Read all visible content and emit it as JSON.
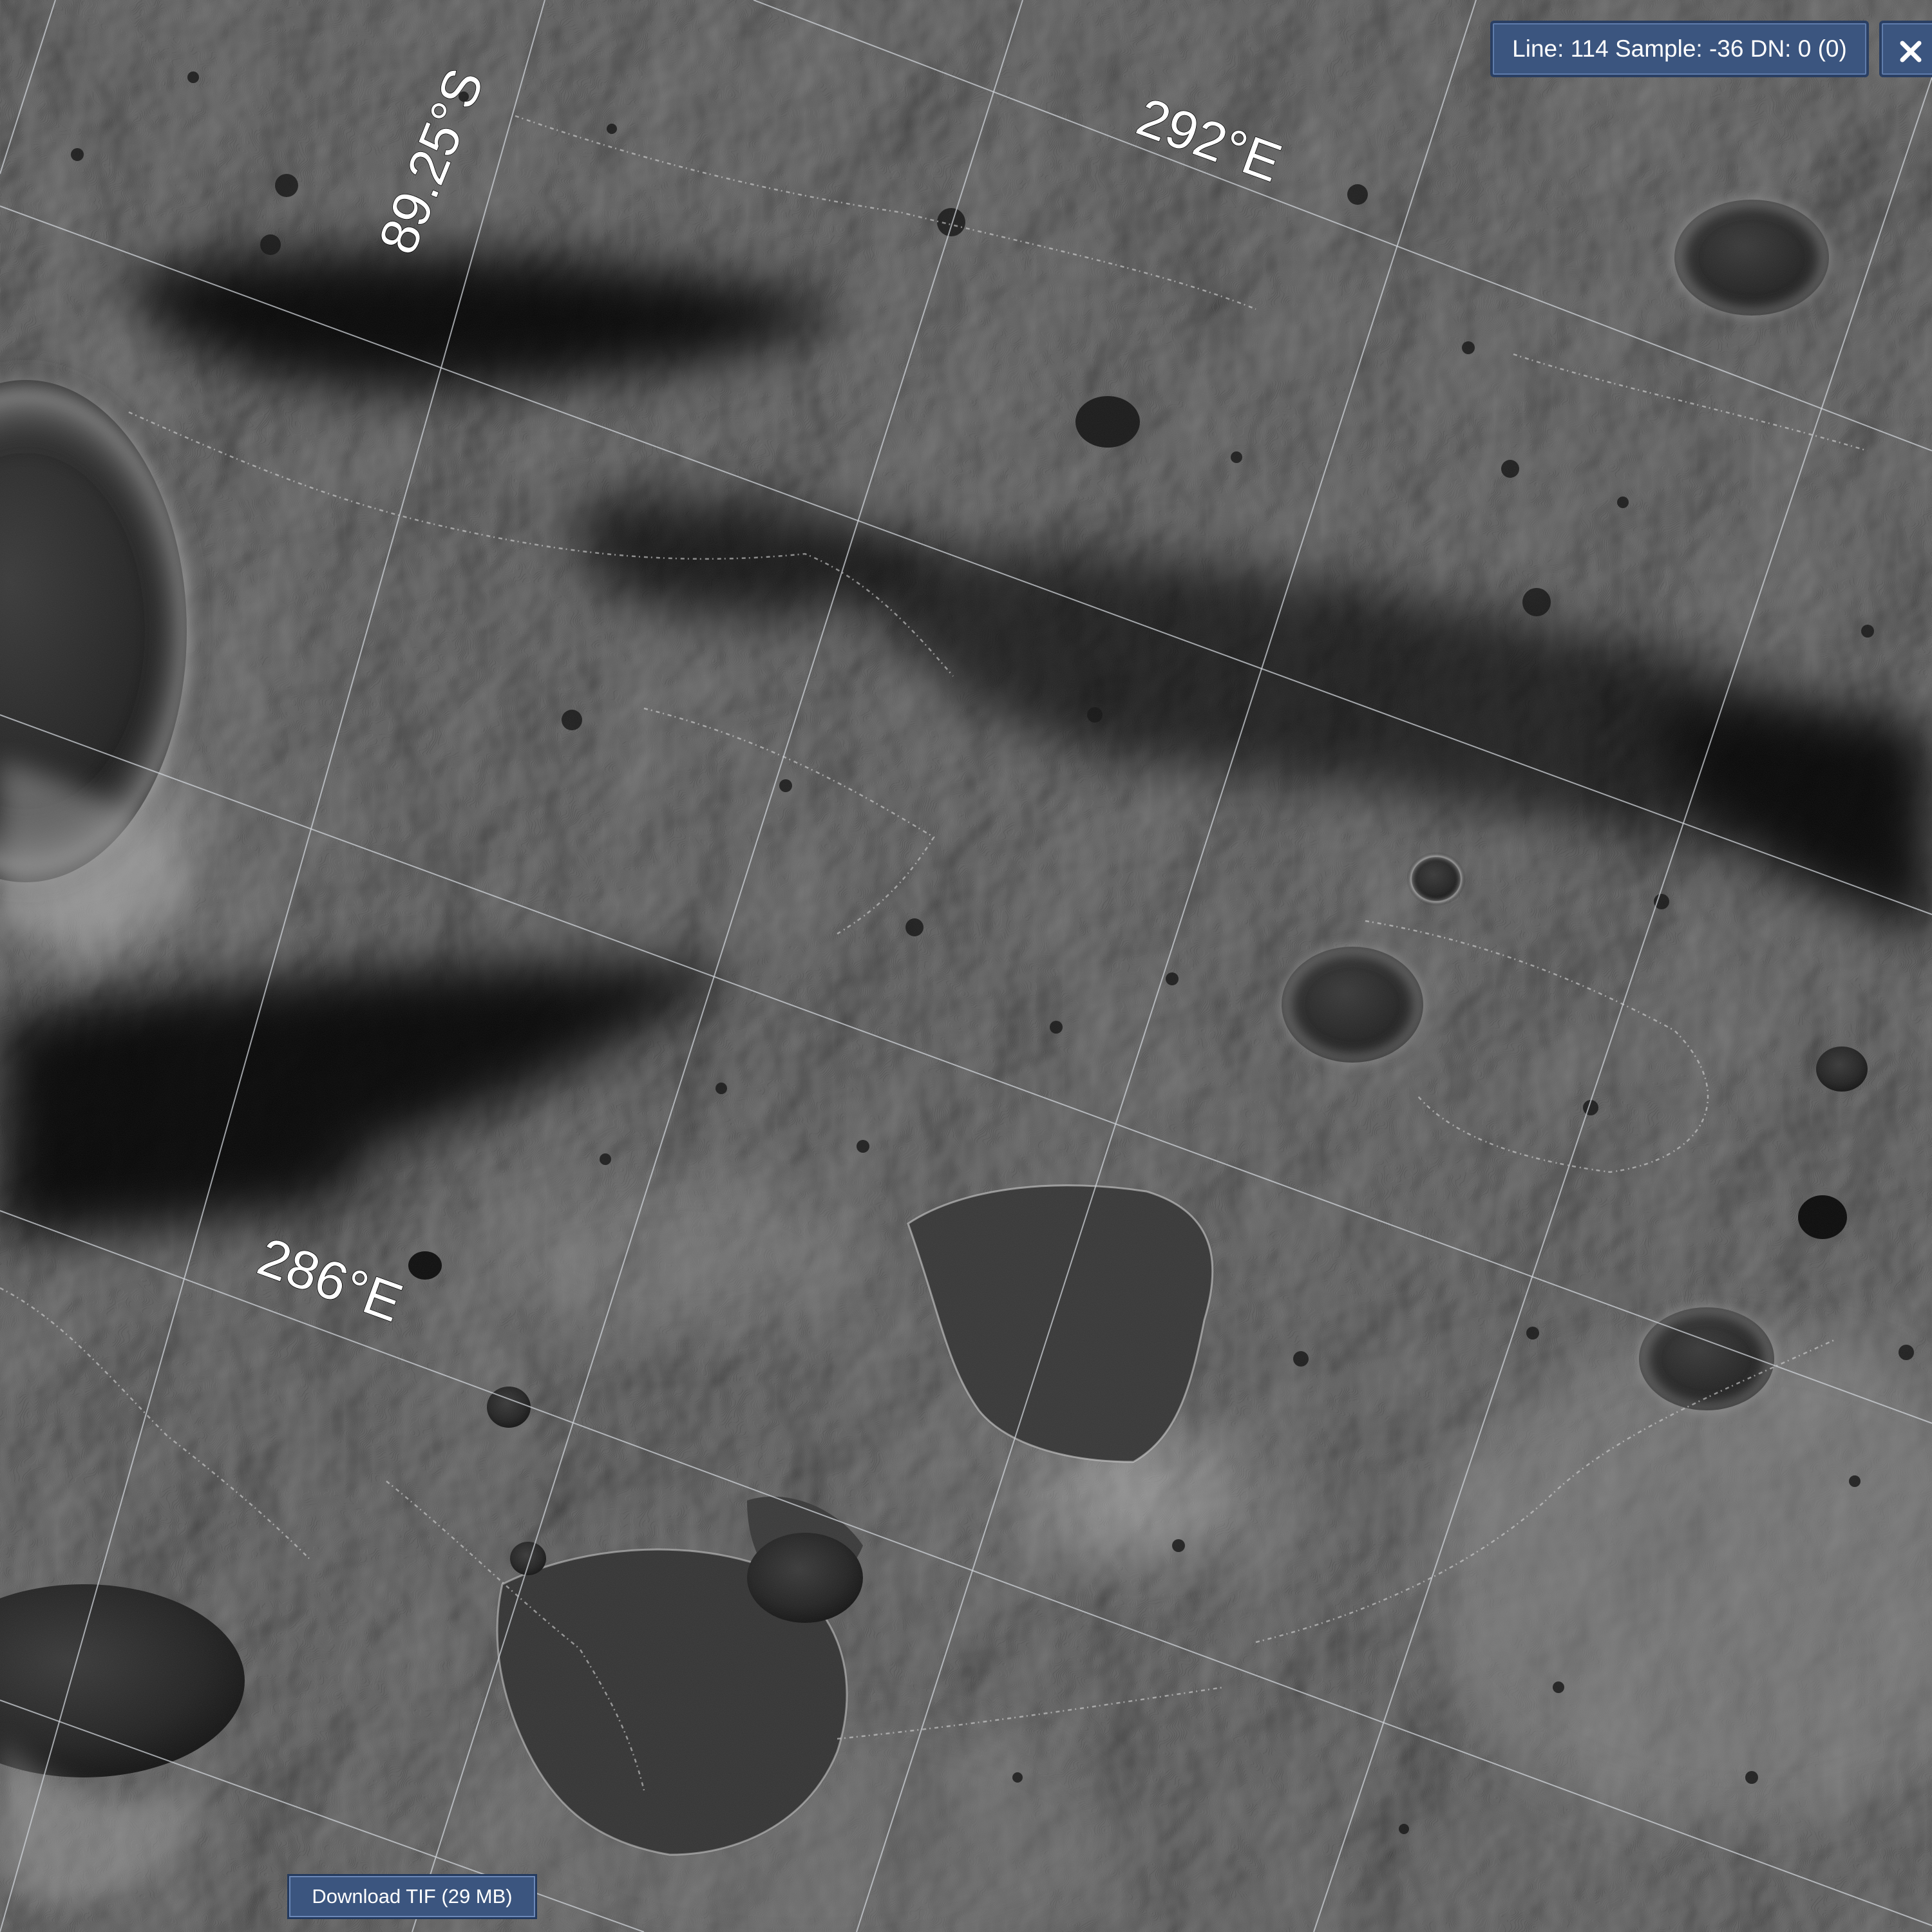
{
  "viewer": {
    "readout": "Line: 114 Sample: -36 DN: 0 (0)",
    "download_label": "Download TIF (29 MB)"
  },
  "map": {
    "grid_labels": {
      "latitude": "89.25°S",
      "longitude_top": "292°E",
      "longitude_bottom": "286°E"
    }
  },
  "colors": {
    "panel_bg": "#3b557f",
    "panel_border": "#2a3f63",
    "grid_line": "#cfd3d8",
    "label_text": "#ffffff"
  },
  "icons": {
    "close": "close-icon"
  }
}
